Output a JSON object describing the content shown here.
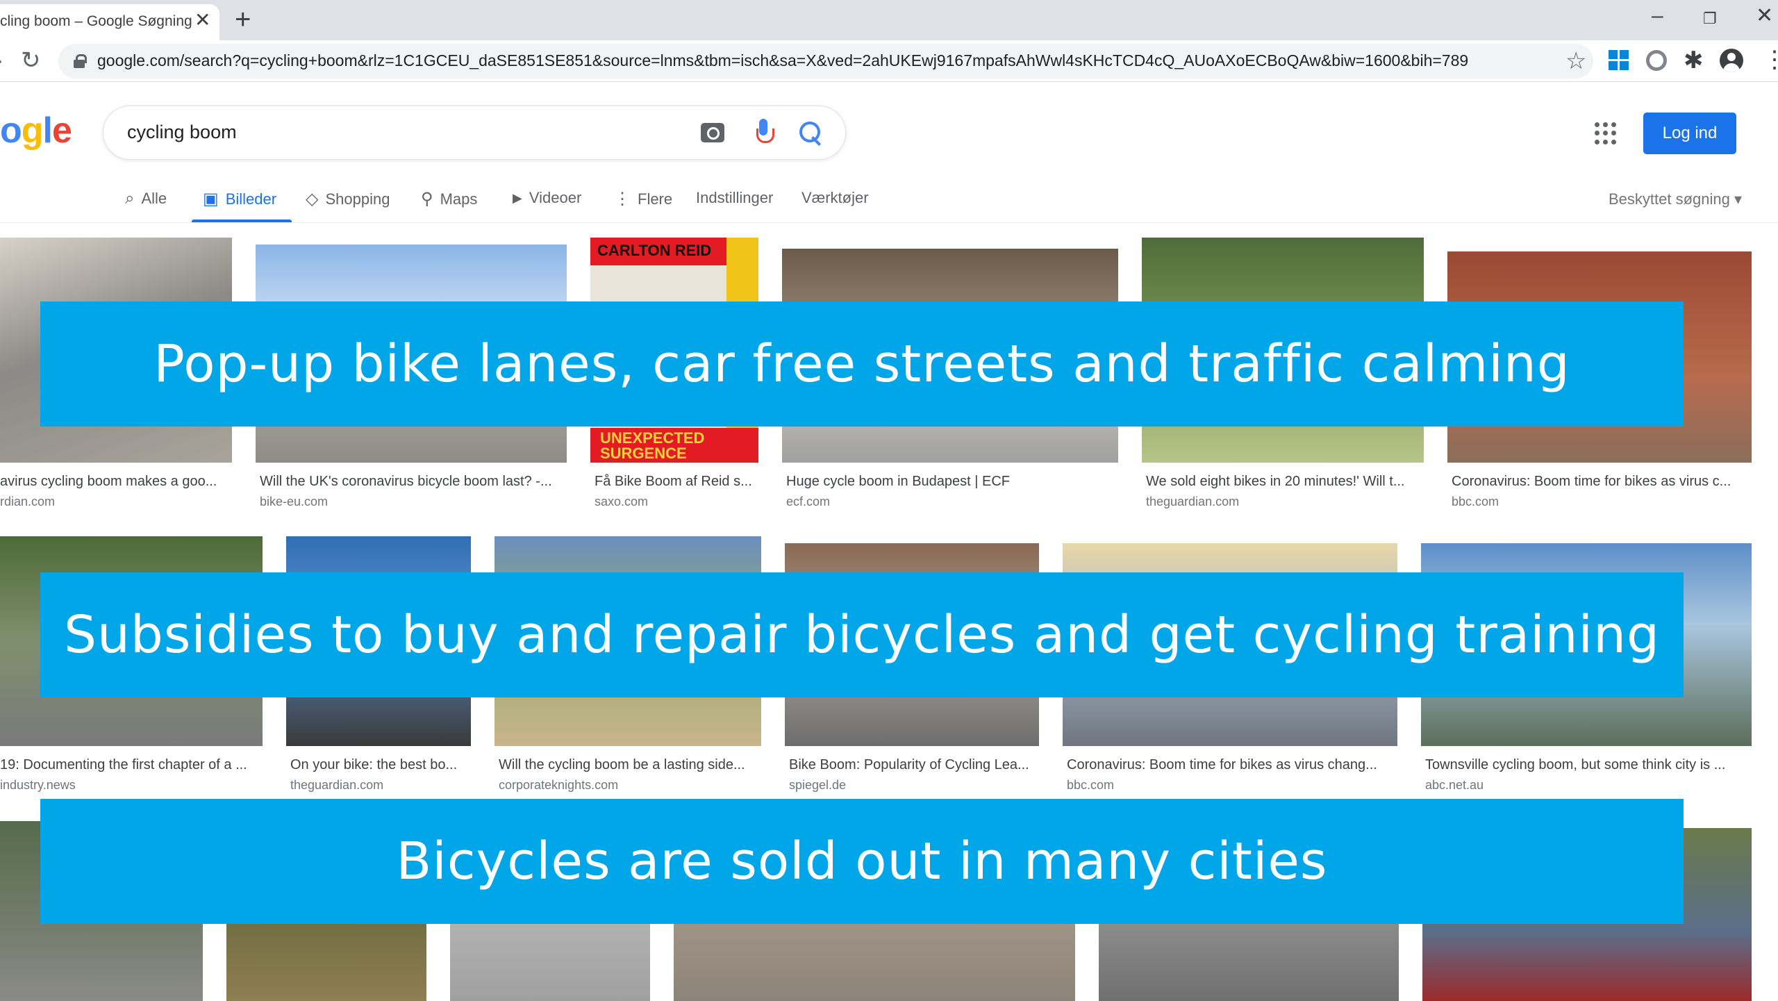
{
  "browser": {
    "tab_title": "cling boom – Google Søgning",
    "tab_close": "✕",
    "new_tab": "+",
    "url": "google.com/search?q=cycling+boom&rlz=1C1GCEU_daSE851SE851&source=lnms&tbm=isch&sa=X&ved=2ahUKEwj9167mpafsAhWwl4sKHcTCD4cQ_AUoAXoECBoQAw&biw=1600&bih=789",
    "window_controls": {
      "minimize": "–",
      "restore": "❐",
      "close": "✕"
    }
  },
  "google": {
    "logo_visible": "ogle",
    "logo_colors": [
      "#4285f4",
      "#fbbc05",
      "#34a853",
      "#ea4335"
    ],
    "search_query": "cycling boom",
    "login_label": "Log ind",
    "safe_search_label": "Beskyttet søgning ▾",
    "tabs": [
      {
        "label": "Alle",
        "icon": "search-icon",
        "glyph": "⌕"
      },
      {
        "label": "Billeder",
        "icon": "images-icon",
        "glyph": "▣",
        "active": true
      },
      {
        "label": "Shopping",
        "icon": "tag-icon",
        "glyph": "◇"
      },
      {
        "label": "Maps",
        "icon": "pin-icon",
        "glyph": "⚲"
      },
      {
        "label": "Videoer",
        "icon": "video-icon",
        "glyph": "▶"
      },
      {
        "label": "Flere",
        "icon": "more-icon",
        "glyph": "⋮"
      },
      {
        "label": "Indstillinger"
      },
      {
        "label": "Værktøjer"
      }
    ]
  },
  "results": [
    {
      "caption": "avirus cycling boom makes a goo...",
      "source": "rdian.com"
    },
    {
      "caption": "Will the UK's coronavirus bicycle boom last? -...",
      "source": "bike-eu.com"
    },
    {
      "caption": "Få Bike Boom af Reid s...",
      "source": "saxo.com",
      "book_top": "CARLTON REID",
      "book_bottom": "UNEXPECTED SURGENCE"
    },
    {
      "caption": "Huge cycle boom in Budapest | ECF",
      "source": "ecf.com"
    },
    {
      "caption": "We sold eight bikes in 20 minutes!' Will t...",
      "source": "theguardian.com"
    },
    {
      "caption": "Coronavirus: Boom time for bikes as virus c...",
      "source": "bbc.com"
    },
    {
      "caption": "19: Documenting the first chapter of a ...",
      "source": "industry.news"
    },
    {
      "caption": "On your bike: the best bo...",
      "source": "theguardian.com"
    },
    {
      "caption": "Will the cycling boom be a lasting side...",
      "source": "corporateknights.com"
    },
    {
      "caption": "Bike Boom: Popularity of Cycling Lea...",
      "source": "spiegel.de"
    },
    {
      "caption": "Coronavirus: Boom time for bikes as virus chang...",
      "source": "bbc.com"
    },
    {
      "caption": "Townsville cycling boom, but some think city is ...",
      "source": "abc.net.au"
    }
  ],
  "banners": [
    "Pop-up bike lanes, car free streets and traffic calming",
    "Subsidies to buy and repair bicycles and get cycling training",
    "Bicycles are sold out in many cities"
  ],
  "colors": {
    "banner": "#00a6e8",
    "accent": "#1a73e8"
  }
}
